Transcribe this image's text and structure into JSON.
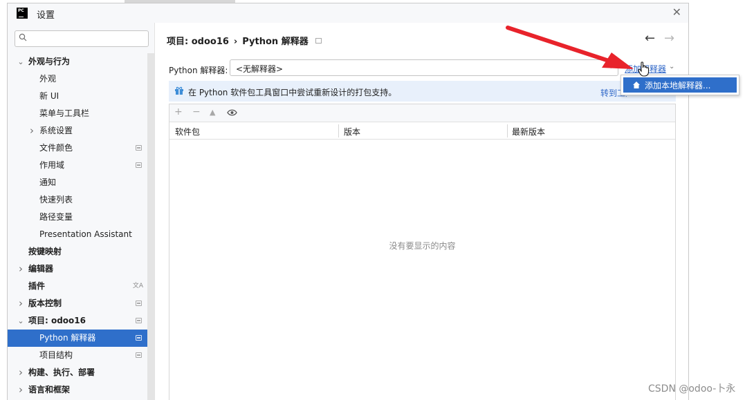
{
  "window": {
    "title": "设置",
    "logo_text": "PC"
  },
  "sidebar": {
    "items": [
      {
        "label": "外观与行为",
        "bold": true,
        "chevron": "down",
        "indent": 0
      },
      {
        "label": "外观",
        "bold": false,
        "chevron": "",
        "indent": 1
      },
      {
        "label": "新 UI",
        "bold": false,
        "chevron": "",
        "indent": 1
      },
      {
        "label": "菜单与工具栏",
        "bold": false,
        "chevron": "",
        "indent": 1
      },
      {
        "label": "系统设置",
        "bold": false,
        "chevron": "right",
        "indent": 1
      },
      {
        "label": "文件颜色",
        "bold": false,
        "chevron": "",
        "indent": 1,
        "badge": true
      },
      {
        "label": "作用域",
        "bold": false,
        "chevron": "",
        "indent": 1,
        "badge": true
      },
      {
        "label": "通知",
        "bold": false,
        "chevron": "",
        "indent": 1
      },
      {
        "label": "快速列表",
        "bold": false,
        "chevron": "",
        "indent": 1
      },
      {
        "label": "路径变量",
        "bold": false,
        "chevron": "",
        "indent": 1
      },
      {
        "label": "Presentation Assistant",
        "bold": false,
        "chevron": "",
        "indent": 1
      },
      {
        "label": "按键映射",
        "bold": true,
        "chevron": "",
        "indent": 0
      },
      {
        "label": "编辑器",
        "bold": true,
        "chevron": "right",
        "indent": 0
      },
      {
        "label": "插件",
        "bold": true,
        "chevron": "",
        "indent": 0,
        "translate": true
      },
      {
        "label": "版本控制",
        "bold": true,
        "chevron": "right",
        "indent": 0,
        "badge": true
      },
      {
        "label": "项目: odoo16",
        "bold": true,
        "chevron": "down",
        "indent": 0,
        "badge": true
      },
      {
        "label": "Python 解释器",
        "bold": false,
        "chevron": "",
        "indent": 1,
        "badge": true,
        "selected": true
      },
      {
        "label": "项目结构",
        "bold": false,
        "chevron": "",
        "indent": 1,
        "badge": true
      },
      {
        "label": "构建、执行、部署",
        "bold": true,
        "chevron": "right",
        "indent": 0
      },
      {
        "label": "语言和框架",
        "bold": true,
        "chevron": "right",
        "indent": 0
      }
    ]
  },
  "breadcrumb": {
    "project": "项目: odoo16",
    "separator": "›",
    "page": "Python 解释器"
  },
  "interpreter": {
    "label": "Python 解释器:",
    "value": "<无解释器>",
    "add_link": "添加解释器"
  },
  "banner": {
    "text": "在 Python 软件包工具窗口中尝试重新设计的打包支持。",
    "link": "转到工具窗口"
  },
  "packages": {
    "columns": [
      "软件包",
      "版本",
      "最新版本"
    ],
    "empty_text": "没有要显示的内容"
  },
  "popup": {
    "item": "添加本地解释器..."
  },
  "watermark": "CSDN @odoo-卜永",
  "colors": {
    "accent": "#2f6fca",
    "link": "#2f67c8",
    "arrow": "#e8232b"
  }
}
